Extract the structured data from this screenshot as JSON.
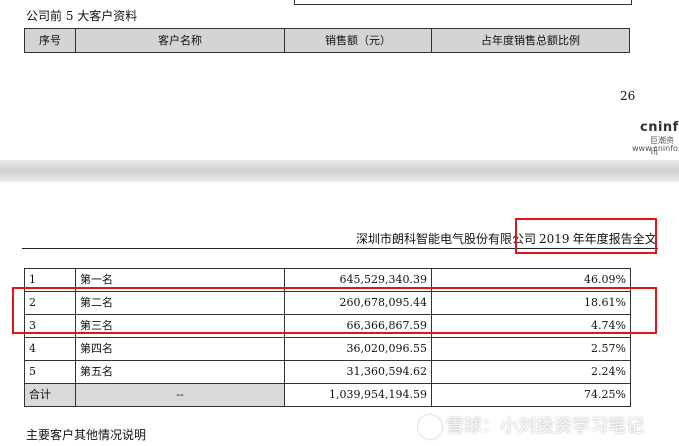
{
  "top": {
    "section_title": "公司前 5 大客户资料",
    "headers": [
      "序号",
      "客户名称",
      "销售额（元）",
      "占年度销售总额比例"
    ],
    "page_number": "26",
    "logo_text": "cninf",
    "logo_cn": "巨潮资讯",
    "logo_url": "www.cninfo."
  },
  "bottom": {
    "report_company": "深圳市朗科智能电气股份有限公司",
    "report_year": "2019",
    "report_suffix": "年年度报告全文",
    "rows": [
      {
        "no": "1",
        "name": "第一名",
        "amount": "645,529,340.39",
        "pct": "46.09%"
      },
      {
        "no": "2",
        "name": "第二名",
        "amount": "260,678,095.44",
        "pct": "18.61%"
      },
      {
        "no": "3",
        "name": "第三名",
        "amount": "66,366,867.59",
        "pct": "4.74%"
      },
      {
        "no": "4",
        "name": "第四名",
        "amount": "36,020,096.55",
        "pct": "2.57%"
      },
      {
        "no": "5",
        "name": "第五名",
        "amount": "31,360,594.62",
        "pct": "2.24%"
      }
    ],
    "total": {
      "label": "合计",
      "name": "--",
      "amount": "1,039,954,194.59",
      "pct": "74.25%"
    },
    "footer_note": "主要客户其他情况说明"
  },
  "watermark": "雪球：小刘投资学习笔记",
  "colors": {
    "highlight": "#e0141a",
    "header_bg": "#d4d4d4"
  }
}
